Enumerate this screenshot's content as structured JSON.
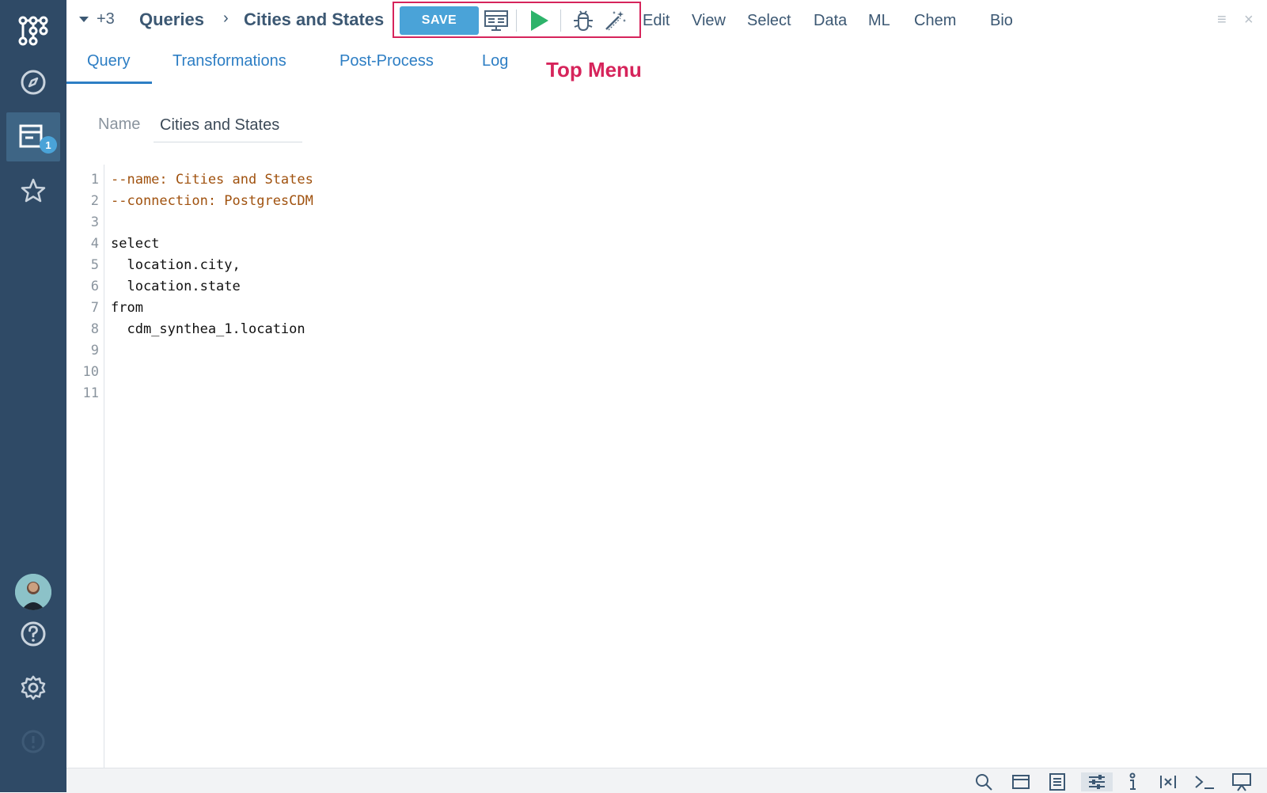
{
  "sidebar": {
    "items": [
      {
        "name": "logo-icon"
      },
      {
        "name": "compass-icon"
      },
      {
        "name": "queries-icon",
        "badge": "1"
      },
      {
        "name": "star-icon"
      },
      {
        "name": "help-icon"
      },
      {
        "name": "settings-icon"
      },
      {
        "name": "alert-icon"
      }
    ]
  },
  "topbar": {
    "more_count": "+3",
    "breadcrumb": [
      "Queries",
      "Cities and States"
    ],
    "save_label": "SAVE",
    "menu": [
      "Edit",
      "View",
      "Select",
      "Data",
      "ML",
      "Chem",
      "Bio"
    ],
    "right_controls": [
      "≡",
      "×"
    ]
  },
  "tabs": [
    "Query",
    "Transformations",
    "Post-Process",
    "Log"
  ],
  "active_tab": "Query",
  "annotation": "Top Menu",
  "form": {
    "name_label": "Name",
    "name_value": "Cities and States"
  },
  "editor": {
    "line_numbers": [
      "1",
      "2",
      "3",
      "4",
      "5",
      "6",
      "7",
      "8",
      "9",
      "10",
      "11"
    ],
    "lines": [
      "--name: Cities and States",
      "--connection: PostgresCDM",
      "",
      "select",
      "  location.city,",
      "  location.state",
      "from",
      "  cdm_synthea_1.location",
      "",
      "",
      ""
    ]
  },
  "colors": {
    "sidebar_bg": "#2f4a66",
    "accent": "#4aa3d8",
    "tab_blue": "#2d7ec4",
    "annotation_red": "#d6245b",
    "comment_color": "#a0520f",
    "run_green": "#2db36a"
  }
}
